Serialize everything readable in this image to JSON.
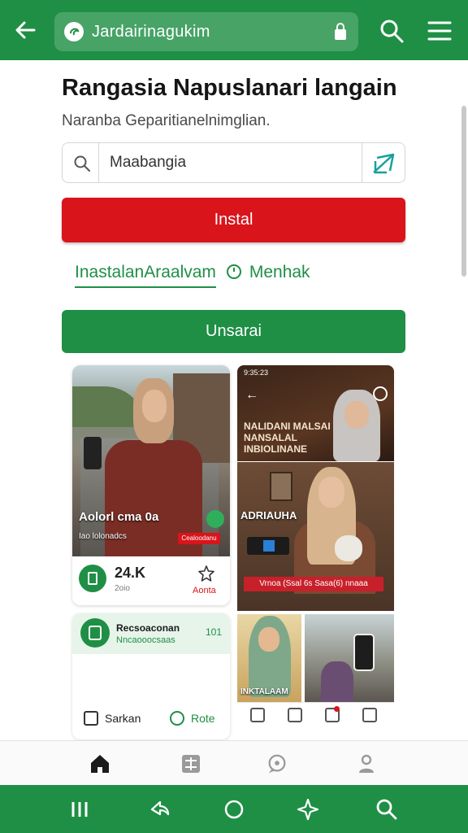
{
  "browser": {
    "url": "Jardairinagukim"
  },
  "page": {
    "title": "Rangasia Napuslanari langain",
    "subtitle": "Naranba Geparitianelnimglian."
  },
  "search": {
    "value": "Maabangia"
  },
  "actions": {
    "install_label": "Instal",
    "link_a": "InastalanAraalvam",
    "link_b": "Menhak",
    "green_button_label": "Unsarai"
  },
  "feed": {
    "left_card": {
      "overlay_title": "Aolorl cma 0a",
      "overlay_sub": "Iao lolonadcs",
      "tag": "Cealoodanu",
      "count": "24.K",
      "count_sub": "2oio",
      "star_label": "Aonta"
    },
    "info_card": {
      "title": "Recsoaconan",
      "subtitle": "Nncaooocsaas",
      "number": "101",
      "action_left": "Sarkan",
      "action_right": "Rote"
    },
    "right_card_1": {
      "statusbar": "9:35:23",
      "headline": "Nalidani malsai nansalal inbiolinane"
    },
    "right_card_2": {
      "headline": "ADRIAUHA",
      "banner": "Vrnoa (Ssal 6s Sasa(6) nnaaa"
    },
    "right_card_3": {
      "label": "INKTALAAM"
    }
  },
  "colors": {
    "brand_green": "#1f8f45",
    "install_red": "#d9141b"
  },
  "icons": {
    "top": [
      "back-arrow-icon",
      "site-icon",
      "lock-icon",
      "search-icon",
      "menu-icon"
    ],
    "bottom_nav": [
      "home-icon",
      "grid-icon",
      "chat-icon",
      "profile-icon"
    ],
    "system_nav": [
      "recents-icon",
      "share-icon",
      "home-circle-icon",
      "sparkle-icon",
      "search-icon"
    ]
  }
}
